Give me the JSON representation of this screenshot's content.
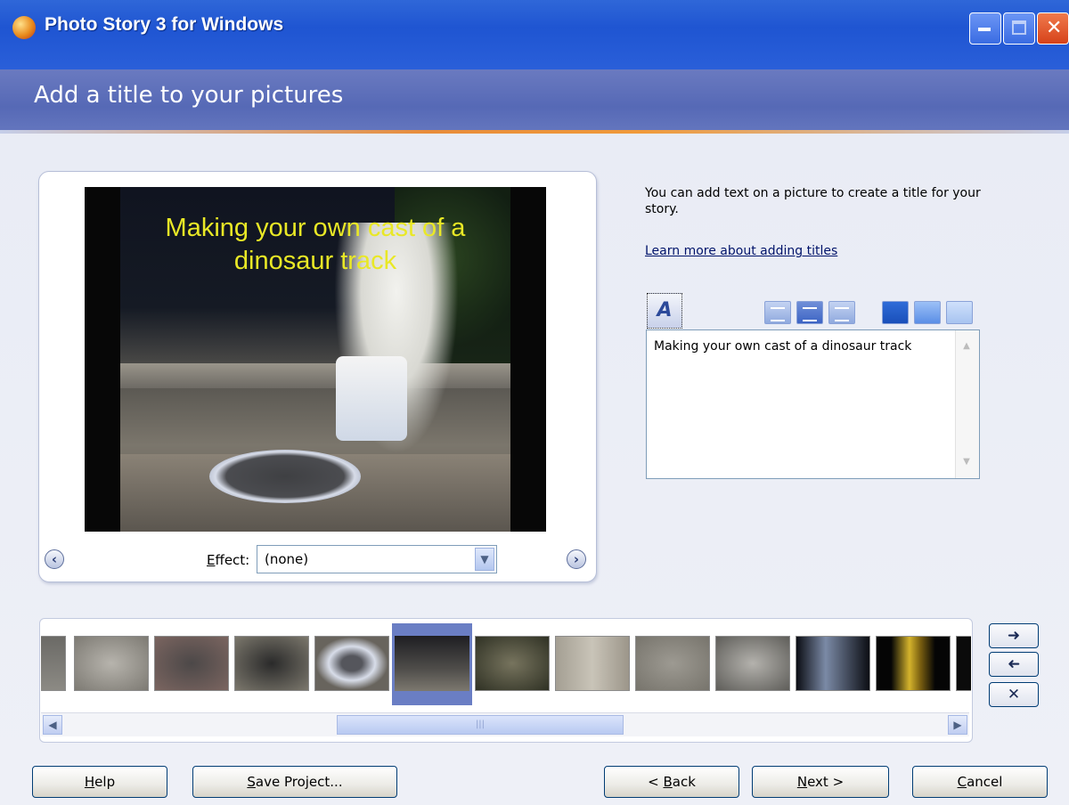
{
  "window": {
    "title": "Photo Story 3 for Windows",
    "controls": {
      "minimize": "minimize-icon",
      "maximize": "maximize-icon",
      "close": "close-icon"
    }
  },
  "header": {
    "title": "Add a title to your pictures"
  },
  "preview": {
    "caption_line1": "Making your own cast of a",
    "caption_line2": "dinosaur track",
    "effect_label_accel": "E",
    "effect_label_rest": "ffect:",
    "effect_value": "(none)"
  },
  "info": {
    "description": "You can add text on a picture to create a title for your story.",
    "learn_link": "Learn more about adding titles"
  },
  "title_text": {
    "value": "Making your own cast of a dinosaur track"
  },
  "colors": {
    "title_bar": "#2a5fd9",
    "header_band": "#5e6fb9",
    "accent_line": "#e88c3a",
    "caption_text": "#e9e826",
    "selected_thumb": "#6a7ec4"
  },
  "filmstrip": {
    "thumb_count": 12,
    "selected_index": 5
  },
  "buttons": {
    "help_accel": "H",
    "help_rest": "elp",
    "save_accel": "S",
    "save_rest": "ave Project...",
    "back_pre": "< ",
    "back_accel": "B",
    "back_rest": "ack",
    "next_accel": "N",
    "next_rest": "ext >",
    "cancel_accel": "C",
    "cancel_rest": "ancel"
  }
}
